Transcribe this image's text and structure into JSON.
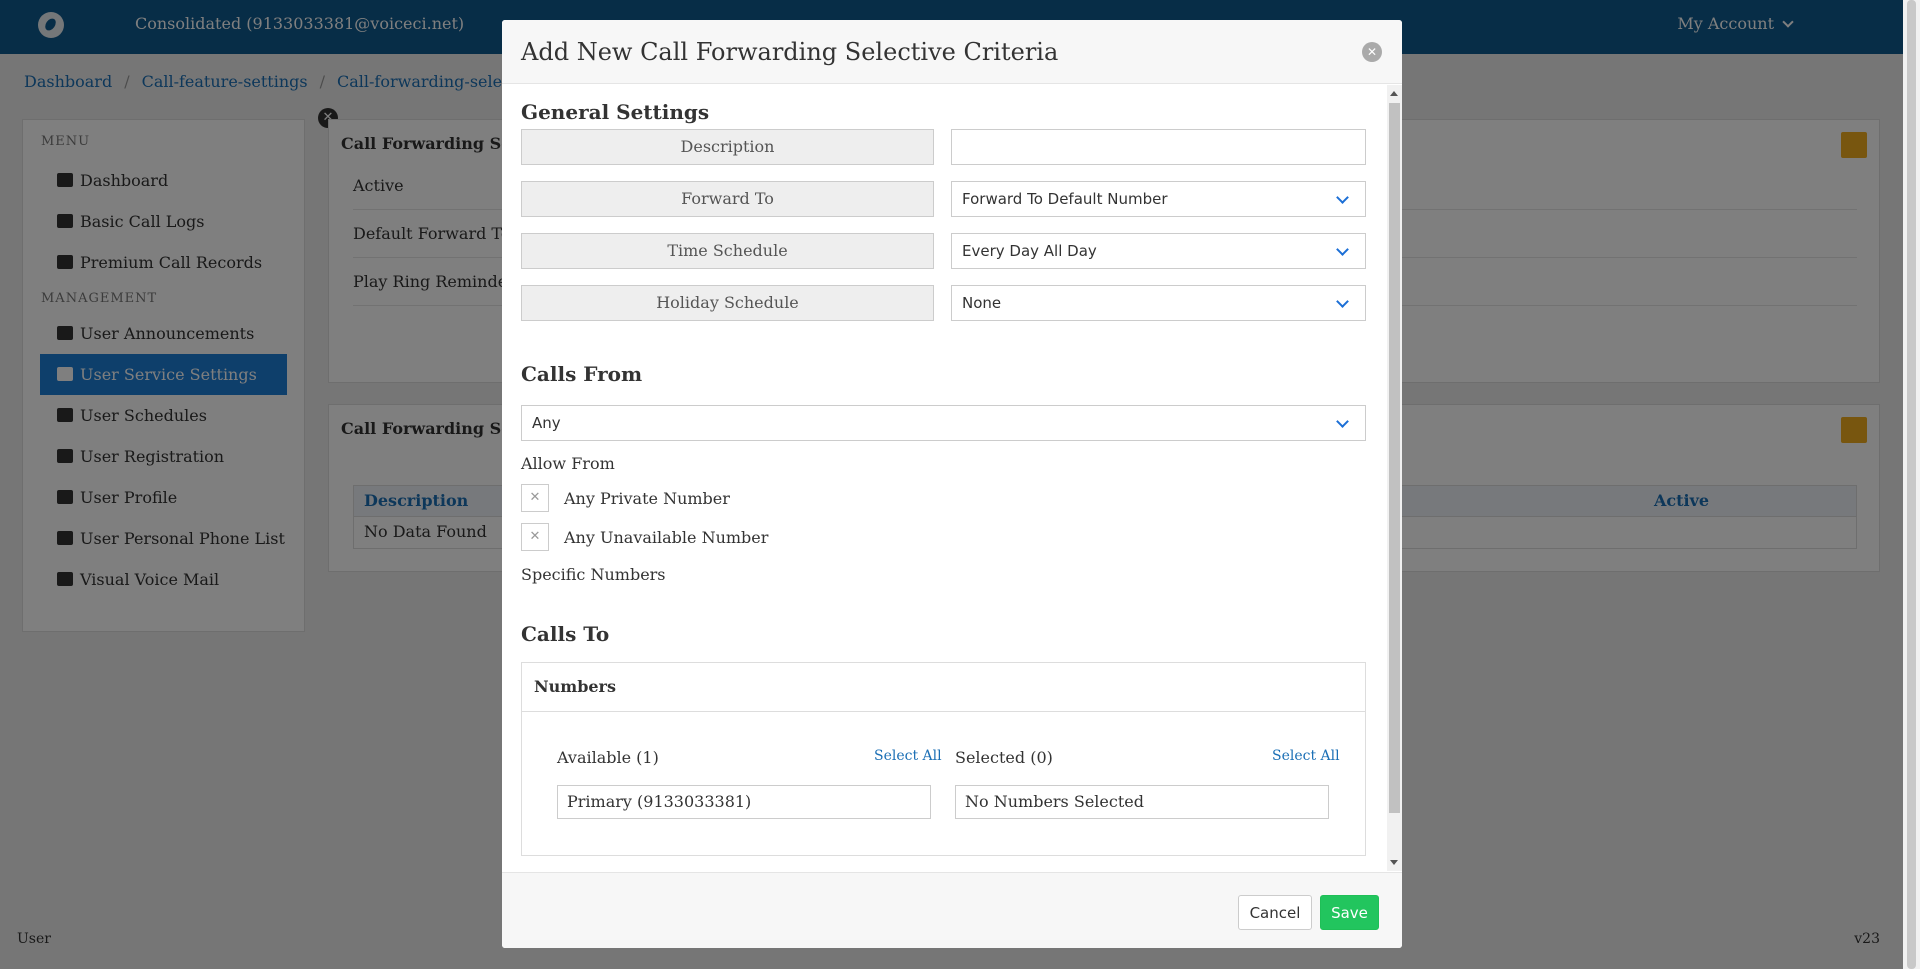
{
  "header": {
    "account_title": "Consolidated (9133033381@voiceci.net)",
    "my_account": "My Account"
  },
  "breadcrumb": [
    "Dashboard",
    "Call-feature-settings",
    "Call-forwarding-selective"
  ],
  "sidebar": {
    "menu_label": "MENU",
    "management_label": "MANAGEMENT",
    "menu_items": [
      {
        "label": "Dashboard",
        "icon": "home-icon"
      },
      {
        "label": "Basic Call Logs",
        "icon": "list-icon"
      },
      {
        "label": "Premium Call Records",
        "icon": "chart-icon"
      }
    ],
    "management_items": [
      {
        "label": "User Announcements",
        "icon": "speaker-icon"
      },
      {
        "label": "User Service Settings",
        "icon": "user-gear-icon",
        "active": true
      },
      {
        "label": "User Schedules",
        "icon": "user-clock-icon"
      },
      {
        "label": "User Registration",
        "icon": "phone-icon"
      },
      {
        "label": "User Profile",
        "icon": "user-icon"
      },
      {
        "label": "User Personal Phone List",
        "icon": "list-icon"
      },
      {
        "label": "Visual Voice Mail",
        "icon": "envelope-icon"
      }
    ]
  },
  "background": {
    "card1_title": "Call Forwarding Sel",
    "card1_rows": [
      "Active",
      "Default Forward To",
      "Play Ring Reminde"
    ],
    "card2_title": "Call Forwarding Sel",
    "table_col_description": "Description",
    "table_col_active": "Active",
    "table_empty": "No Data Found"
  },
  "modal": {
    "title": "Add New Call Forwarding Selective Criteria",
    "general_settings": {
      "heading": "General Settings",
      "description_label": "Description",
      "description_value": "",
      "forward_to_label": "Forward To",
      "forward_to_value": "Forward To Default Number",
      "time_schedule_label": "Time Schedule",
      "time_schedule_value": "Every Day All Day",
      "holiday_schedule_label": "Holiday Schedule",
      "holiday_schedule_value": "None"
    },
    "calls_from": {
      "heading": "Calls From",
      "selected": "Any",
      "allow_from_label": "Allow From",
      "any_private_label": "Any Private Number",
      "any_unavailable_label": "Any Unavailable Number",
      "specific_numbers_label": "Specific Numbers"
    },
    "calls_to": {
      "heading": "Calls To",
      "panel_title": "Numbers",
      "available_label": "Available (1)",
      "selected_label": "Selected (0)",
      "select_all": "Select All",
      "available_items": [
        "Primary (9133033381)"
      ],
      "selected_empty": "No Numbers Selected"
    },
    "buttons": {
      "cancel": "Cancel",
      "save": "Save"
    }
  },
  "footer": {
    "left": "User",
    "right": "v23"
  },
  "colors": {
    "header_bg": "#0f5a8e",
    "accent_blue": "#1c7ed6",
    "save_green": "#22c55e",
    "action_orange": "#f0ad1e"
  }
}
